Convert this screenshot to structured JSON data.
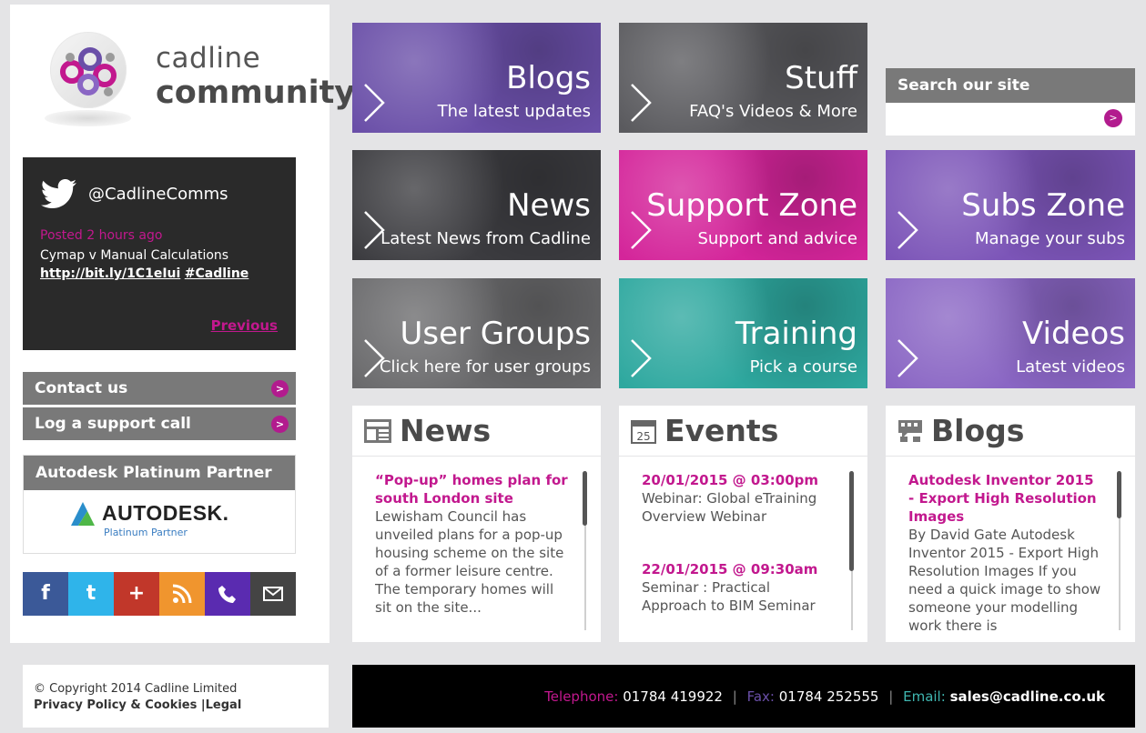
{
  "brand": {
    "line1": "cadline",
    "line2": "community"
  },
  "twitter": {
    "handle": "@CadlineComms",
    "posted": "Posted 2 hours ago",
    "text": "Cymap v Manual Calculations",
    "link": "http://bit.ly/1C1eIui",
    "hashtag": "#Cadline",
    "previous": "Previous"
  },
  "sidebar": {
    "contact": "Contact us",
    "support": "Log a support call",
    "partner_heading": "Autodesk Platinum Partner",
    "autodesk": "AUTODESK.",
    "autodesk_sub": "Platinum Partner"
  },
  "social": [
    "f",
    "t",
    "+",
    "rss",
    "phone",
    "mail"
  ],
  "tiles": [
    {
      "title": "Blogs",
      "sub": "The latest updates",
      "color": "#6a4fa8"
    },
    {
      "title": "Stuff",
      "sub": "FAQ's Videos & More",
      "color": "#5a5a5e"
    },
    {
      "title": "News",
      "sub": "Latest News from Cadline",
      "color": "#3c3c40"
    },
    {
      "title": "Support Zone",
      "sub": "Support and advice",
      "color": "#d4259a"
    },
    {
      "title": "Subs Zone",
      "sub": "Manage your subs",
      "color": "#7c55b8"
    },
    {
      "title": "User Groups",
      "sub": "Click here for user groups",
      "color": "#6a6a6c"
    },
    {
      "title": "Training",
      "sub": "Pick a course",
      "color": "#2ea89f"
    },
    {
      "title": "Videos",
      "sub": "Latest videos",
      "color": "#8a66c4"
    }
  ],
  "search": {
    "heading": "Search our site",
    "placeholder": ""
  },
  "panels": {
    "news": {
      "title": "News",
      "item_title": "“Pop-up” homes plan for south London site",
      "item_text": "Lewisham Council has unveiled plans for a pop-up housing scheme on the site of a former leisure centre. The temporary homes will sit on the site..."
    },
    "events": {
      "title": "Events",
      "calendar_day": "25",
      "e1_date": "20/01/2015 @ 03:00pm",
      "e1_text": "Webinar: Global eTraining Overview Webinar",
      "e2_date": "22/01/2015 @ 09:30am",
      "e2_text": "Seminar : Practical Approach to BIM Seminar"
    },
    "blogs": {
      "title": "Blogs",
      "item_title": "Autodesk Inventor 2015 - Export High Resolution Images",
      "item_text": "By David Gate Autodesk Inventor 2015 - Export High Resolution Images If you need a quick image to show someone your modelling work there is"
    }
  },
  "footer": {
    "copyright": "© Copyright 2014 Cadline Limited",
    "privacy": "Privacy Policy & Cookies",
    "legal": "Legal",
    "tel_label": "Telephone:",
    "tel": "01784 419922",
    "fax_label": "Fax:",
    "fax": "01784 252555",
    "email_label": "Email:",
    "email": "sales@cadline.co.uk"
  },
  "colors": {
    "magenta": "#c2188e",
    "grey": "#797979",
    "purple": "#6a4fa8",
    "teal": "#2ea89f"
  }
}
